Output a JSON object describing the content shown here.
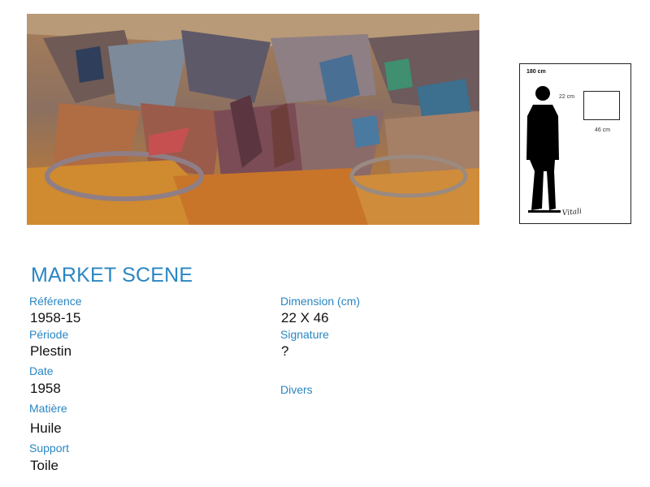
{
  "artwork": {
    "title": "MARKET SCENE",
    "scale_panel": {
      "height_label": "180 cm",
      "height_dim_label": "22 cm",
      "width_dim_label": "46 cm",
      "signature": "Vitali"
    }
  },
  "fields": {
    "reference": {
      "label": "Référence",
      "value": "1958-15"
    },
    "periode": {
      "label": "Période",
      "value": "Plestin"
    },
    "date": {
      "label": "Date",
      "value": "1958"
    },
    "matiere": {
      "label": "Matière",
      "value": "Huile"
    },
    "support": {
      "label": "Support",
      "value": "Toile"
    },
    "dimension": {
      "label": "Dimension (cm)",
      "value": "22 X 46"
    },
    "signature": {
      "label": "Signature",
      "value": "?"
    },
    "divers": {
      "label": "Divers"
    }
  },
  "colors": {
    "accent": "#2a86c2",
    "text": "#111111"
  }
}
